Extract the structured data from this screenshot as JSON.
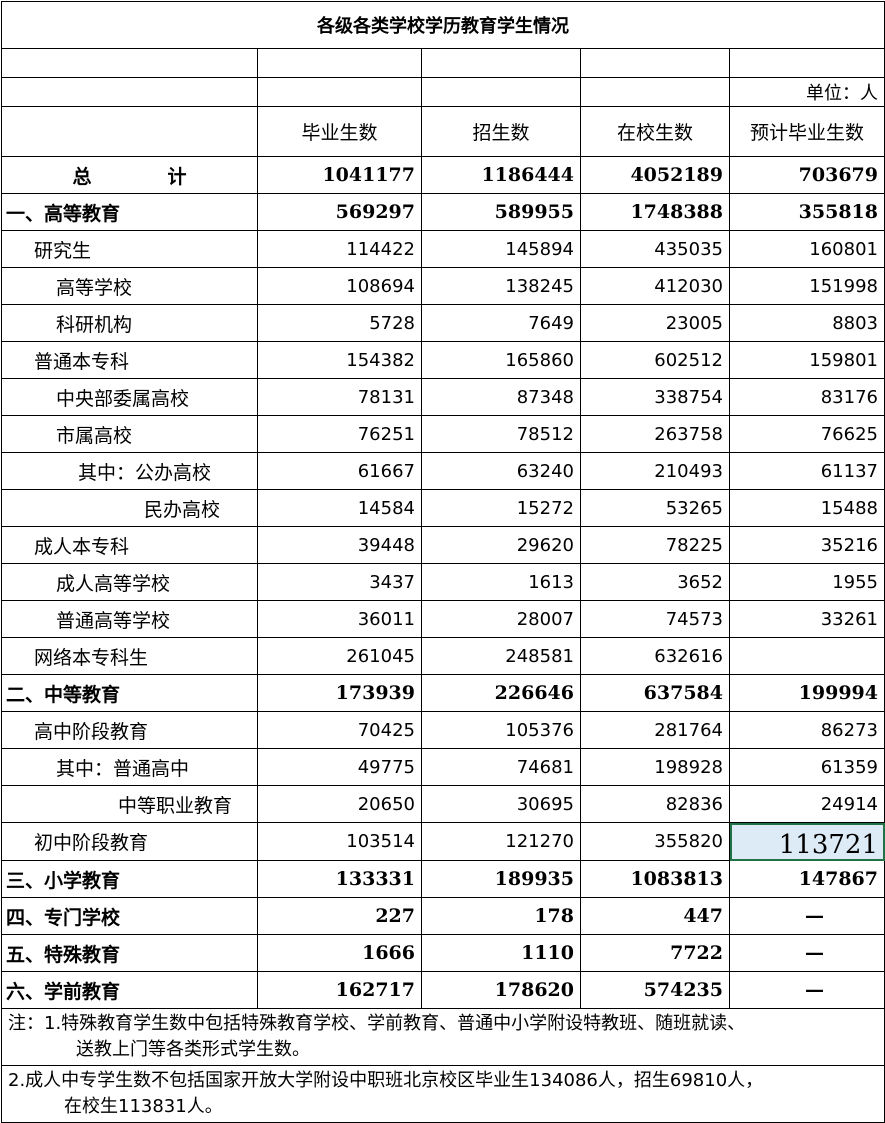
{
  "title": "各级各类学校学历教育学生情况",
  "unit": "单位：人",
  "columns": [
    "毕业生数",
    "招生数",
    "在校生数",
    "预计毕业生数"
  ],
  "rows": [
    {
      "label": "总　　　　计",
      "bold": true,
      "indent": 0,
      "center": true,
      "values": [
        "1041177",
        "1186444",
        "4052189",
        "703679"
      ]
    },
    {
      "label": "一、高等教育",
      "bold": true,
      "indent": 0,
      "values": [
        "569297",
        "589955",
        "1748388",
        "355818"
      ]
    },
    {
      "label": "研究生",
      "bold": false,
      "indent": 1,
      "values": [
        "114422",
        "145894",
        "435035",
        "160801"
      ]
    },
    {
      "label": "高等学校",
      "bold": false,
      "indent": 2,
      "values": [
        "108694",
        "138245",
        "412030",
        "151998"
      ]
    },
    {
      "label": "科研机构",
      "bold": false,
      "indent": 2,
      "values": [
        "5728",
        "7649",
        "23005",
        "8803"
      ]
    },
    {
      "label": "普通本专科",
      "bold": false,
      "indent": 1,
      "values": [
        "154382",
        "165860",
        "602512",
        "159801"
      ]
    },
    {
      "label": "中央部委属高校",
      "bold": false,
      "indent": 2,
      "values": [
        "78131",
        "87348",
        "338754",
        "83176"
      ]
    },
    {
      "label": "市属高校",
      "bold": false,
      "indent": 2,
      "values": [
        "76251",
        "78512",
        "263758",
        "76625"
      ]
    },
    {
      "label": "其中：公办高校",
      "bold": false,
      "indent": 3,
      "values": [
        "61667",
        "63240",
        "210493",
        "61137"
      ]
    },
    {
      "label": "民办高校",
      "bold": false,
      "indent": 5,
      "values": [
        "14584",
        "15272",
        "53265",
        "15488"
      ]
    },
    {
      "label": "成人本专科",
      "bold": false,
      "indent": 1,
      "values": [
        "39448",
        "29620",
        "78225",
        "35216"
      ]
    },
    {
      "label": "成人高等学校",
      "bold": false,
      "indent": 2,
      "values": [
        "3437",
        "1613",
        "3652",
        "1955"
      ]
    },
    {
      "label": "普通高等学校",
      "bold": false,
      "indent": 2,
      "values": [
        "36011",
        "28007",
        "74573",
        "33261"
      ]
    },
    {
      "label": "网络本专科生",
      "bold": false,
      "indent": 1,
      "values": [
        "261045",
        "248581",
        "632616",
        ""
      ]
    },
    {
      "label": "二、中等教育",
      "bold": true,
      "indent": 0,
      "values": [
        "173939",
        "226646",
        "637584",
        "199994"
      ]
    },
    {
      "label": "高中阶段教育",
      "bold": false,
      "indent": 1,
      "values": [
        "70425",
        "105376",
        "281764",
        "86273"
      ]
    },
    {
      "label": "其中：普通高中",
      "bold": false,
      "indent": 2,
      "values": [
        "49775",
        "74681",
        "198928",
        "61359"
      ]
    },
    {
      "label": "中等职业教育",
      "bold": false,
      "indent": 4,
      "values": [
        "20650",
        "30695",
        "82836",
        "24914"
      ]
    },
    {
      "label": "初中阶段教育",
      "bold": false,
      "indent": 1,
      "values": [
        "103514",
        "121270",
        "355820",
        "113721"
      ],
      "selected_col": 3
    },
    {
      "label": "三、小学教育",
      "bold": true,
      "indent": 0,
      "values": [
        "133331",
        "189935",
        "1083813",
        "147867"
      ]
    },
    {
      "label": "四、专门学校",
      "bold": true,
      "indent": 0,
      "values": [
        "227",
        "178",
        "447",
        "—"
      ]
    },
    {
      "label": "五、特殊教育",
      "bold": true,
      "indent": 0,
      "values": [
        "1666",
        "1110",
        "7722",
        "—"
      ]
    },
    {
      "label": "六、学前教育",
      "bold": true,
      "indent": 0,
      "values": [
        "162717",
        "178620",
        "574235",
        "—"
      ]
    }
  ],
  "notes": {
    "note1_line1": "注：1.特殊教育学生数中包括特殊教育学校、学前教育、普通中小学附设特教班、随班就读、",
    "note1_line2": "送教上门等各类形式学生数。",
    "note2_line1": "2.成人中专学生数不包括国家开放大学附设中职班北京校区毕业生134086人，招生69810人，",
    "note2_line2": "在校生113831人。"
  },
  "colors": {
    "grid": "#000000",
    "selection_border": "#217346",
    "selection_fill": "#ddebf7"
  }
}
